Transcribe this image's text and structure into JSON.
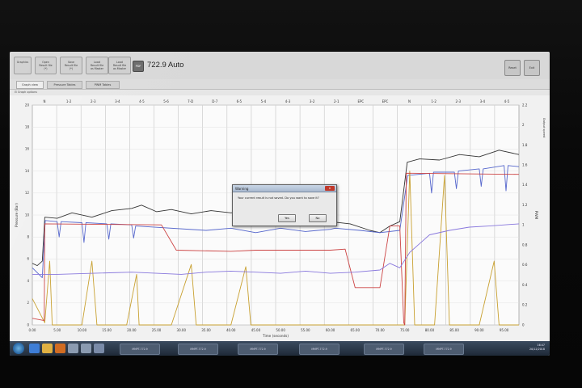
{
  "app": {
    "title": "722.9 Auto",
    "badge": "PDF",
    "toolbar": [
      {
        "label": "Graphics"
      },
      {
        "label": "Open\nResult file\n(*)"
      },
      {
        "label": "Save\nResult file\n(*)"
      },
      {
        "label": "Load\nResult file\nas Master"
      },
      {
        "label": "Load\nResult file\nas Master"
      }
    ],
    "right_buttons": [
      {
        "label": "Reset"
      },
      {
        "label": "Exit"
      }
    ],
    "tabs": [
      {
        "label": "Graph view"
      },
      {
        "label": "Pressure Tables"
      },
      {
        "label": "PWM Tables"
      }
    ],
    "graph_options_label": "Graph options"
  },
  "dialog": {
    "title": "Warning",
    "message": "Your current result is not saved. Do you want to save it?",
    "yes_label": "Yes",
    "no_label": "No"
  },
  "taskbar": {
    "tasks": [
      "MMPT-772.9",
      "MMPT-772.9",
      "MMPT-772.9",
      "MMPT-772.9",
      "MMPT-772.9",
      "MMPT-772.9",
      "MMPT-772.9"
    ],
    "time": "16:47",
    "date": "20/12/2018"
  },
  "chart_data": {
    "type": "line",
    "xlabel": "Time (seconds)",
    "ylabel_left": "Pressure (Bar)",
    "ylabel_right": "PWM",
    "ylabel_right_outer": "Output speed",
    "xlim": [
      0,
      98
    ],
    "ylim_left": [
      0,
      20
    ],
    "ylim_right": [
      0,
      2.2
    ],
    "x_ticks": [
      "0.00",
      "5.00",
      "10.00",
      "15.00",
      "20.00",
      "25.00",
      "30.00",
      "35.00",
      "40.00",
      "45.00",
      "50.00",
      "55.00",
      "60.00",
      "65.00",
      "70.00",
      "75.00",
      "80.00",
      "85.00",
      "90.00",
      "95.00"
    ],
    "y_ticks_left": [
      "0",
      "2",
      "4",
      "6",
      "8",
      "10",
      "12",
      "14",
      "16",
      "18",
      "20"
    ],
    "y_ticks_right": [
      "0",
      "0.2",
      "0.4",
      "0.6",
      "0.8",
      "1",
      "1.2",
      "1.4",
      "1.6",
      "1.8",
      "2",
      "2.2"
    ],
    "gear_labels": [
      "N",
      "1-2",
      "2-3",
      "3-4",
      "4-5",
      "5-6",
      "7-D",
      "D-7",
      "6-5",
      "5-4",
      "4-3",
      "3-2",
      "2-1",
      "EPC",
      "EPC",
      "N",
      "1-2",
      "2-3",
      "3-4",
      "4-5"
    ],
    "series": [
      {
        "color": "#333333",
        "points": [
          [
            0,
            5.6
          ],
          [
            1,
            5.4
          ],
          [
            2,
            5.8
          ],
          [
            2.5,
            9.8
          ],
          [
            5,
            9.7
          ],
          [
            8,
            10.2
          ],
          [
            12,
            9.8
          ],
          [
            16,
            10.4
          ],
          [
            20,
            10.6
          ],
          [
            22,
            10.9
          ],
          [
            25,
            10.3
          ],
          [
            28,
            10.5
          ],
          [
            32,
            10.1
          ],
          [
            36,
            10.4
          ],
          [
            40,
            10.2
          ],
          [
            44,
            10.4
          ],
          [
            48,
            10.0
          ],
          [
            52,
            9.8
          ],
          [
            56,
            9.6
          ],
          [
            60,
            9.4
          ],
          [
            64,
            9.2
          ],
          [
            68,
            8.6
          ],
          [
            70,
            8.4
          ],
          [
            72,
            9.0
          ],
          [
            74,
            9.4
          ],
          [
            75.5,
            14.8
          ],
          [
            78,
            15.1
          ],
          [
            82,
            15.0
          ],
          [
            86,
            15.5
          ],
          [
            90,
            15.3
          ],
          [
            94,
            15.9
          ],
          [
            98,
            15.5
          ]
        ]
      },
      {
        "color": "#5566cc",
        "points": [
          [
            0,
            5.2
          ],
          [
            2,
            4.3
          ],
          [
            2.6,
            9.5
          ],
          [
            5,
            9.4
          ],
          [
            5.4,
            8.0
          ],
          [
            5.8,
            9.4
          ],
          [
            10,
            9.3
          ],
          [
            10.4,
            7.5
          ],
          [
            10.8,
            9.3
          ],
          [
            15,
            9.2
          ],
          [
            15.4,
            7.8
          ],
          [
            15.8,
            9.2
          ],
          [
            20,
            9.1
          ],
          [
            20.4,
            7.9
          ],
          [
            20.8,
            9.0
          ],
          [
            35,
            8.6
          ],
          [
            40,
            8.8
          ],
          [
            45,
            8.4
          ],
          [
            50,
            8.8
          ],
          [
            55,
            8.5
          ],
          [
            60,
            8.7
          ],
          [
            61,
            8.8
          ],
          [
            66,
            8.6
          ],
          [
            70,
            8.4
          ],
          [
            74,
            8.6
          ],
          [
            75.6,
            13.6
          ],
          [
            80,
            13.8
          ],
          [
            80.4,
            12.0
          ],
          [
            80.8,
            13.9
          ],
          [
            85,
            13.9
          ],
          [
            85.4,
            12.4
          ],
          [
            85.8,
            14.0
          ],
          [
            90,
            14.2
          ],
          [
            90.4,
            12.6
          ],
          [
            90.8,
            14.2
          ],
          [
            95,
            14.5
          ],
          [
            95.4,
            12.2
          ],
          [
            95.8,
            14.5
          ],
          [
            98,
            14.4
          ]
        ]
      },
      {
        "color": "#c8a030",
        "points": [
          [
            0,
            2.4
          ],
          [
            2.5,
            0.2
          ],
          [
            3.5,
            5.8
          ],
          [
            4,
            0
          ],
          [
            10,
            0
          ],
          [
            12,
            5.8
          ],
          [
            13,
            0
          ],
          [
            19,
            0
          ],
          [
            21,
            4.6
          ],
          [
            21.5,
            0
          ],
          [
            28,
            0
          ],
          [
            32,
            5.5
          ],
          [
            33,
            0
          ],
          [
            40,
            0
          ],
          [
            43,
            5.3
          ],
          [
            44,
            0
          ],
          [
            60,
            0
          ],
          [
            61,
            0
          ],
          [
            75,
            0
          ],
          [
            76,
            14.0
          ],
          [
            77,
            0
          ],
          [
            81,
            0
          ],
          [
            83,
            13.6
          ],
          [
            84,
            0
          ],
          [
            90,
            0
          ],
          [
            93,
            5.8
          ],
          [
            94,
            0
          ],
          [
            98,
            0
          ]
        ]
      },
      {
        "color": "#cc4444",
        "points": [
          [
            0,
            0.6
          ],
          [
            2.4,
            0.4
          ],
          [
            2.5,
            9.2
          ],
          [
            26,
            9.1
          ],
          [
            29,
            6.8
          ],
          [
            40,
            6.7
          ],
          [
            45,
            6.8
          ],
          [
            60,
            6.8
          ],
          [
            63,
            6.9
          ],
          [
            65,
            3.4
          ],
          [
            70,
            3.4
          ],
          [
            72,
            9.0
          ],
          [
            74,
            9.0
          ],
          [
            74.8,
            0.2
          ],
          [
            75,
            0
          ],
          [
            75.3,
            13.8
          ],
          [
            98,
            13.7
          ]
        ]
      },
      {
        "color": "#8877dd",
        "points": [
          [
            0,
            4.6
          ],
          [
            5,
            4.6
          ],
          [
            20,
            4.8
          ],
          [
            25,
            4.7
          ],
          [
            30,
            4.6
          ],
          [
            35,
            4.8
          ],
          [
            40,
            4.9
          ],
          [
            45,
            4.8
          ],
          [
            50,
            4.7
          ],
          [
            55,
            4.9
          ],
          [
            60,
            4.7
          ],
          [
            65,
            4.8
          ],
          [
            70,
            5.0
          ],
          [
            72,
            5.6
          ],
          [
            74,
            5.2
          ],
          [
            76,
            6.6
          ],
          [
            78,
            7.4
          ],
          [
            80,
            8.2
          ],
          [
            84,
            8.6
          ],
          [
            88,
            8.9
          ],
          [
            92,
            9.0
          ],
          [
            98,
            9.2
          ]
        ]
      }
    ]
  }
}
